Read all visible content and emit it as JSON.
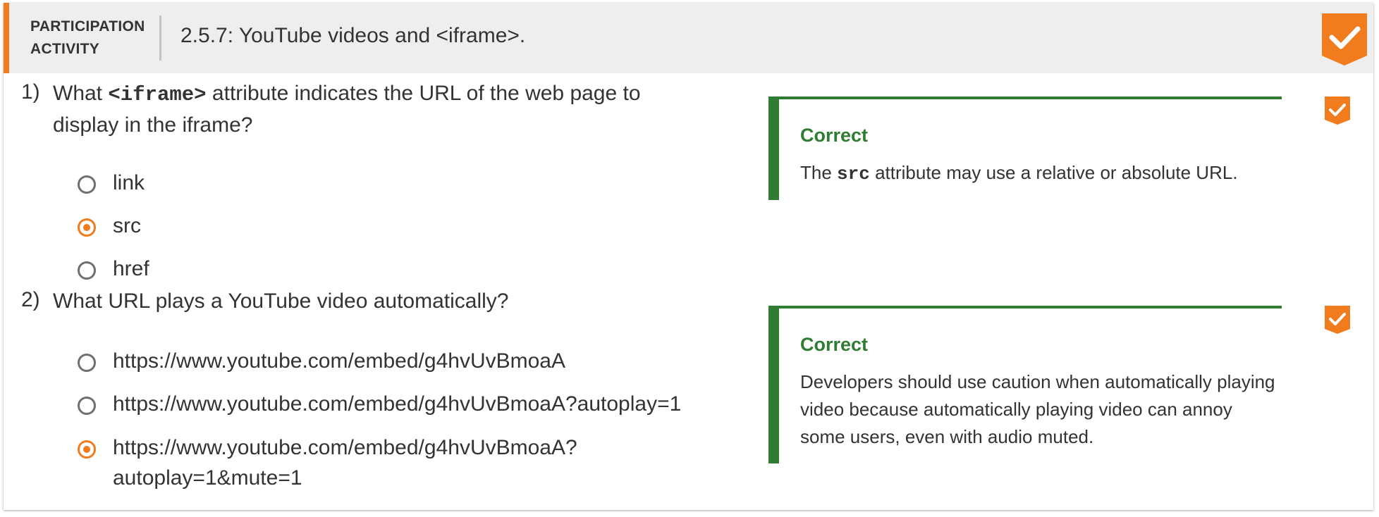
{
  "header": {
    "label_line1": "PARTICIPATION",
    "label_line2": "ACTIVITY",
    "title": "2.5.7: YouTube videos and <iframe>."
  },
  "colors": {
    "accent": "#f07c1e",
    "correct": "#2e7d32",
    "header_bg": "#eeeeee"
  },
  "questions": [
    {
      "number": "1)",
      "text_before": "What ",
      "code": "<iframe>",
      "text_after": " attribute indicates the URL of the web page to display in the iframe?",
      "options": [
        {
          "label": "link",
          "selected": false
        },
        {
          "label": "src",
          "selected": true
        },
        {
          "label": "href",
          "selected": false
        }
      ],
      "feedback": {
        "title": "Correct",
        "text_before": "The ",
        "code": "src",
        "text_after": " attribute may use a relative or absolute URL."
      },
      "status_icon": "check-icon"
    },
    {
      "number": "2)",
      "text": "What URL plays a YouTube video automatically?",
      "options": [
        {
          "label": "https://www.youtube.com/embed/g4hvUvBmoaA",
          "selected": false
        },
        {
          "label": "https://www.youtube.com/embed/g4hvUvBmoaA?autoplay=1",
          "selected": false
        },
        {
          "label_line1": "https://www.youtube.com/embed/g4hvUvBmoaA?",
          "label_line2": "autoplay=1&mute=1",
          "selected": true
        }
      ],
      "feedback": {
        "title": "Correct",
        "text": "Developers should use caution when automatically playing video because automatically playing video can annoy some users, even with audio muted."
      },
      "status_icon": "check-icon"
    }
  ]
}
